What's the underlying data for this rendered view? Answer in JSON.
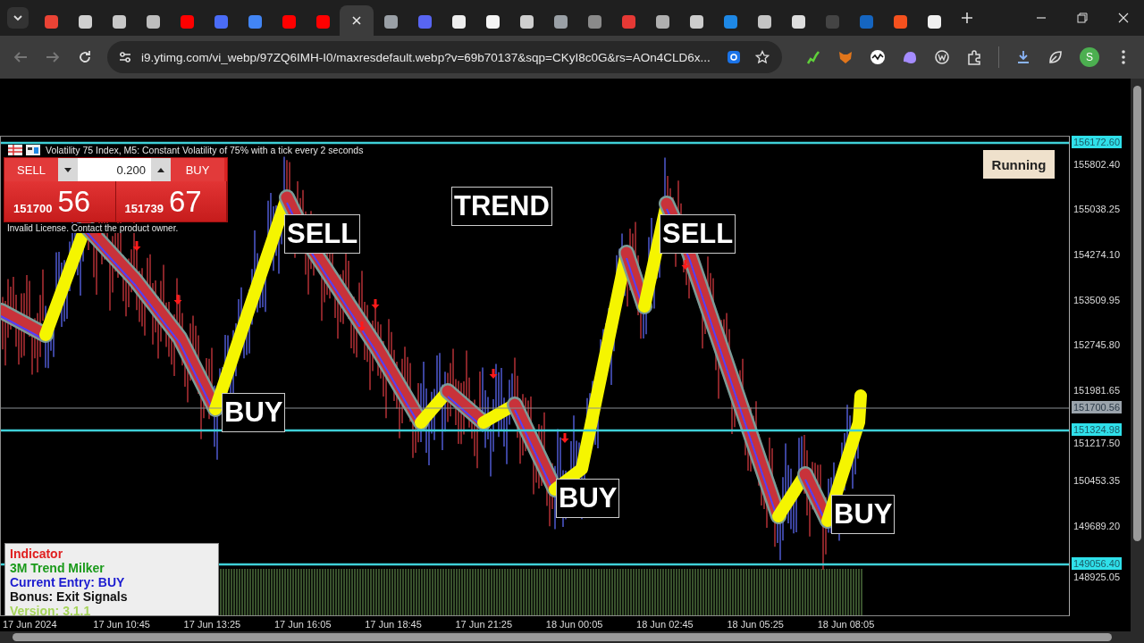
{
  "browser": {
    "tabs": [
      {
        "selected": false,
        "color": "#ea4335"
      },
      {
        "selected": false,
        "color": "#d0d0d0"
      },
      {
        "selected": false,
        "color": "#c8c8c8"
      },
      {
        "selected": false,
        "color": "#bdbdbd"
      },
      {
        "selected": false,
        "color": "#ff0000"
      },
      {
        "selected": false,
        "color": "#4a6cf7"
      },
      {
        "selected": false,
        "color": "#4285f4"
      },
      {
        "selected": false,
        "color": "#ff0000"
      },
      {
        "selected": false,
        "color": "#ff0000"
      },
      {
        "selected": true
      },
      {
        "selected": false,
        "color": "#9aa0a6"
      },
      {
        "selected": false,
        "color": "#5865f2"
      },
      {
        "selected": false,
        "color": "#eeeeee"
      },
      {
        "selected": false,
        "color": "#f5f5f5"
      },
      {
        "selected": false,
        "color": "#cfcfcf"
      },
      {
        "selected": false,
        "color": "#9aa0a6"
      },
      {
        "selected": false,
        "color": "#8a8a8a"
      },
      {
        "selected": false,
        "color": "#e53935"
      },
      {
        "selected": false,
        "color": "#b0b0b0"
      },
      {
        "selected": false,
        "color": "#cccccc"
      },
      {
        "selected": false,
        "color": "#1e88e5"
      },
      {
        "selected": false,
        "color": "#c4c4c4"
      },
      {
        "selected": false,
        "color": "#dddddd"
      },
      {
        "selected": false,
        "color": "#444444"
      },
      {
        "selected": false,
        "color": "#1565c0"
      },
      {
        "selected": false,
        "color": "#f4511e"
      },
      {
        "selected": false,
        "color": "#f0f0f0"
      }
    ],
    "url": "i9.ytimg.com/vi_webp/97ZQ6IMH-I0/maxresdefault.webp?v=69b70137&sqp=CKyI8c0G&rs=AOn4CLD6x...",
    "profile_initial": "S"
  },
  "chart": {
    "header": "Volatility 75 Index, M5:  Constant Volatility of 75% with a tick every 2 seconds",
    "trade_panel": {
      "sell_label": "SELL",
      "lot": "0.200",
      "buy_label": "BUY",
      "sell_price": "151700",
      "sell_pips": "56",
      "buy_price": "151739",
      "buy_pips": "67"
    },
    "notice": "Invalid License. Contact the product owner.",
    "status_button": "Running",
    "labels": [
      "TREND",
      "SELL",
      "SELL",
      "BUY",
      "BUY",
      "BUY"
    ],
    "price_axis": [
      {
        "kind": "line_tag",
        "text": "156172.60"
      },
      {
        "kind": "tick",
        "text": "155802.40"
      },
      {
        "kind": "tick",
        "text": "155038.25"
      },
      {
        "kind": "tick",
        "text": "154274.10"
      },
      {
        "kind": "tick",
        "text": "153509.95"
      },
      {
        "kind": "tick",
        "text": "152745.80"
      },
      {
        "kind": "tick",
        "text": "151981.65"
      },
      {
        "kind": "bid_tag",
        "text": "151700.56"
      },
      {
        "kind": "line_tag",
        "text": "151324.98"
      },
      {
        "kind": "tick",
        "text": "151217.50"
      },
      {
        "kind": "tick",
        "text": "150453.35"
      },
      {
        "kind": "tick",
        "text": "149689.20"
      },
      {
        "kind": "line_tag",
        "text": "149056.40"
      },
      {
        "kind": "tick",
        "text": "148925.05"
      }
    ],
    "time_axis": [
      "17 Jun 2024",
      "17 Jun 10:45",
      "17 Jun 13:25",
      "17 Jun 16:05",
      "17 Jun 18:45",
      "17 Jun 21:25",
      "18 Jun 00:05",
      "18 Jun 02:45",
      "18 Jun 05:25",
      "18 Jun 08:05"
    ],
    "info_box": [
      {
        "text": "Indicator",
        "color": "#e02020"
      },
      {
        "text": "3M Trend Milker",
        "color": "#1a9a1a"
      },
      {
        "text": "Current Entry: BUY",
        "color": "#1c1cd0"
      },
      {
        "text": "Bonus: Exit Signals",
        "color": "#111111"
      },
      {
        "text": "Version: 3.1.1",
        "color": "#a6d45a"
      }
    ]
  }
}
